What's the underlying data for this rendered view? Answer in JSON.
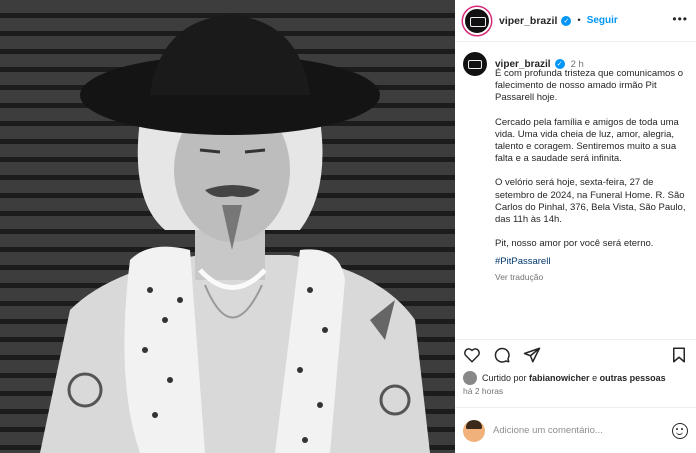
{
  "post": {
    "username": "viper_brazil",
    "follow_label": "Seguir",
    "separator": "•",
    "more_label": "•••",
    "verified_glyph": "✓"
  },
  "caption": {
    "username": "viper_brazil",
    "time": "2 h",
    "paragraphs": [
      "É com profunda tristeza que comunicamos o falecimento de nosso amado irmão Pit Passarell hoje.",
      "Cercado pela família e amigos de toda uma vida. Uma vida cheia de luz, amor, alegria, talento e coragem. Sentiremos muito a sua falta e a saudade será infinita.",
      "O velório será hoje, sexta-feira, 27 de setembro de 2024, na Funeral Home. R. São Carlos do Pinhal, 376, Bela Vista, São Paulo, das 11h às 14h.",
      "Pit, nosso amor por você será eterno."
    ],
    "hashtag": "#PitPassarell",
    "translate_label": "Ver tradução"
  },
  "engagement": {
    "liked_prefix": "Curtido por",
    "liked_user": "fabianowicher",
    "liked_joiner": "e",
    "liked_others": "outras pessoas",
    "time_ago": "há 2 horas"
  },
  "comment": {
    "placeholder": "Adicione um comentário..."
  },
  "icons": [
    "heart-icon",
    "comment-icon",
    "share-icon",
    "save-icon",
    "emoji-icon",
    "verified-badge-icon"
  ],
  "colors": {
    "accent": "#0095f6",
    "text": "#262626",
    "muted": "#737373",
    "hashtag": "#00376b"
  }
}
